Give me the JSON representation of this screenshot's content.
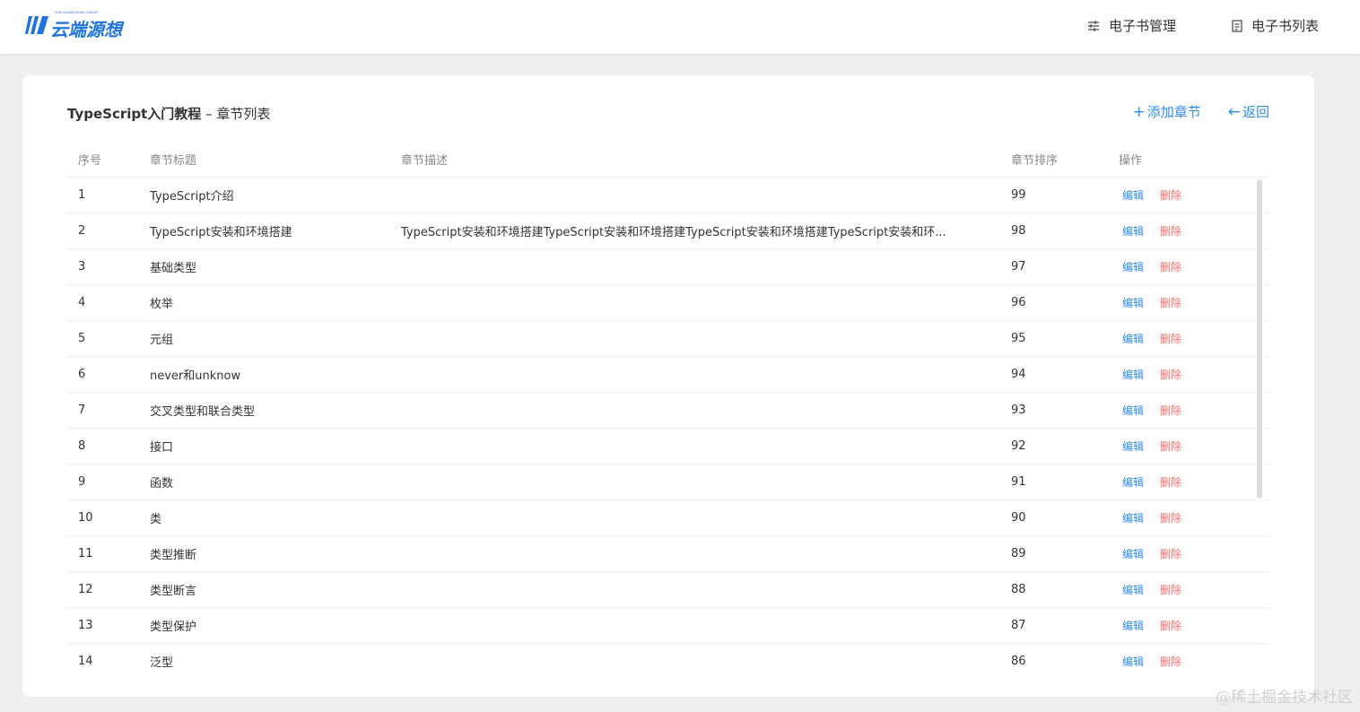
{
  "header": {
    "logo_sub": "YUN DUANYUAN XIANG",
    "logo_text": "云端源想",
    "nav": [
      {
        "label": "电子书管理",
        "icon": "sliders-icon"
      },
      {
        "label": "电子书列表",
        "icon": "document-list-icon"
      }
    ]
  },
  "page": {
    "book_name": "TypeScript入门教程",
    "separator": " – ",
    "subtitle": "章节列表",
    "add_label": "添加章节",
    "back_label": "返回"
  },
  "table": {
    "headers": {
      "no": "序号",
      "title": "章节标题",
      "desc": "章节描述",
      "sort": "章节排序",
      "op": "操作"
    },
    "edit_label": "编辑",
    "delete_label": "删除",
    "rows": [
      {
        "no": "1",
        "title": "TypeScript介绍",
        "desc": "",
        "sort": "99"
      },
      {
        "no": "2",
        "title": "TypeScript安装和环境搭建",
        "desc": "TypeScript安装和环境搭建TypeScript安装和环境搭建TypeScript安装和环境搭建TypeScript安装和环...",
        "sort": "98"
      },
      {
        "no": "3",
        "title": "基础类型",
        "desc": "",
        "sort": "97"
      },
      {
        "no": "4",
        "title": "枚举",
        "desc": "",
        "sort": "96"
      },
      {
        "no": "5",
        "title": "元组",
        "desc": "",
        "sort": "95"
      },
      {
        "no": "6",
        "title": "never和unknow",
        "desc": "",
        "sort": "94"
      },
      {
        "no": "7",
        "title": "交叉类型和联合类型",
        "desc": "",
        "sort": "93"
      },
      {
        "no": "8",
        "title": "接口",
        "desc": "",
        "sort": "92"
      },
      {
        "no": "9",
        "title": "函数",
        "desc": "",
        "sort": "91"
      },
      {
        "no": "10",
        "title": "类",
        "desc": "",
        "sort": "90"
      },
      {
        "no": "11",
        "title": "类型推断",
        "desc": "",
        "sort": "89"
      },
      {
        "no": "12",
        "title": "类型断言",
        "desc": "",
        "sort": "88"
      },
      {
        "no": "13",
        "title": "类型保护",
        "desc": "",
        "sort": "87"
      },
      {
        "no": "14",
        "title": "泛型",
        "desc": "",
        "sort": "86"
      }
    ]
  },
  "watermark": "@稀土掘金技术社区",
  "colors": {
    "accent": "#2d8cf0",
    "danger": "#f56c6c",
    "logo": "#1f74e0"
  }
}
